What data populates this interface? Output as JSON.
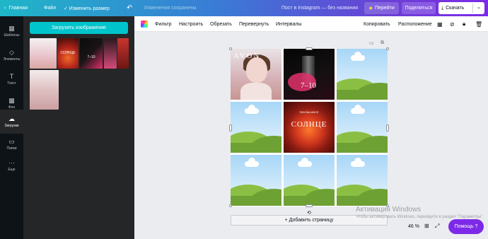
{
  "topbar": {
    "back_label": "Главная",
    "file_label": "Файл",
    "resize_label": "✓ Изменить размер",
    "undo_icon": "undo-icon",
    "saved_status": "Изменения сохранены",
    "doc_title": "Пост в Instagram — без названия",
    "go_label": "Перейти",
    "share_label": "Поделиться",
    "download_label": "Скачать"
  },
  "rail": {
    "items": [
      {
        "label": "Шаблоны",
        "icon": "templates-icon"
      },
      {
        "label": "Элементы",
        "icon": "elements-icon"
      },
      {
        "label": "Текст",
        "icon": "text-icon"
      },
      {
        "label": "Фон",
        "icon": "background-icon"
      },
      {
        "label": "Загрузки",
        "icon": "uploads-icon"
      },
      {
        "label": "Папки",
        "icon": "folder-icon"
      },
      {
        "label": "Еще",
        "icon": "more-icon"
      }
    ]
  },
  "panel": {
    "upload_label": "Загрузить изображение",
    "thumbs": [
      {
        "text": ""
      },
      {
        "text": "СОЛНЦЕ"
      },
      {
        "text": "7–10"
      },
      {
        "text": ""
      },
      {
        "text": ""
      },
      {
        "text": ""
      }
    ]
  },
  "toolbar": {
    "filter": "Фильтр",
    "adjust": "Настроить",
    "crop": "Обрезать",
    "flip": "Перевернуть",
    "spacing": "Интервалы",
    "copy_style": "Копировать",
    "position": "Расположение"
  },
  "canvas": {
    "avon_text": "AVON",
    "lip_text": "7–10",
    "sun_top": "TAN BALANCE",
    "sun_word": "СОЛНЦЕ",
    "add_page": "+ Добавить страницу"
  },
  "watermark": {
    "line1": "Активация Windows",
    "line2": "Чтобы активировать Windows, перейдите в раздел \"Параметры\"."
  },
  "footer": {
    "zoom": "46 %",
    "help": "Помощь ?"
  },
  "colors": {
    "accent_purple": "#7d2ae8",
    "upload_teal": "#00c4cc",
    "rail_bg": "#0e1318",
    "panel_bg": "#252627"
  }
}
